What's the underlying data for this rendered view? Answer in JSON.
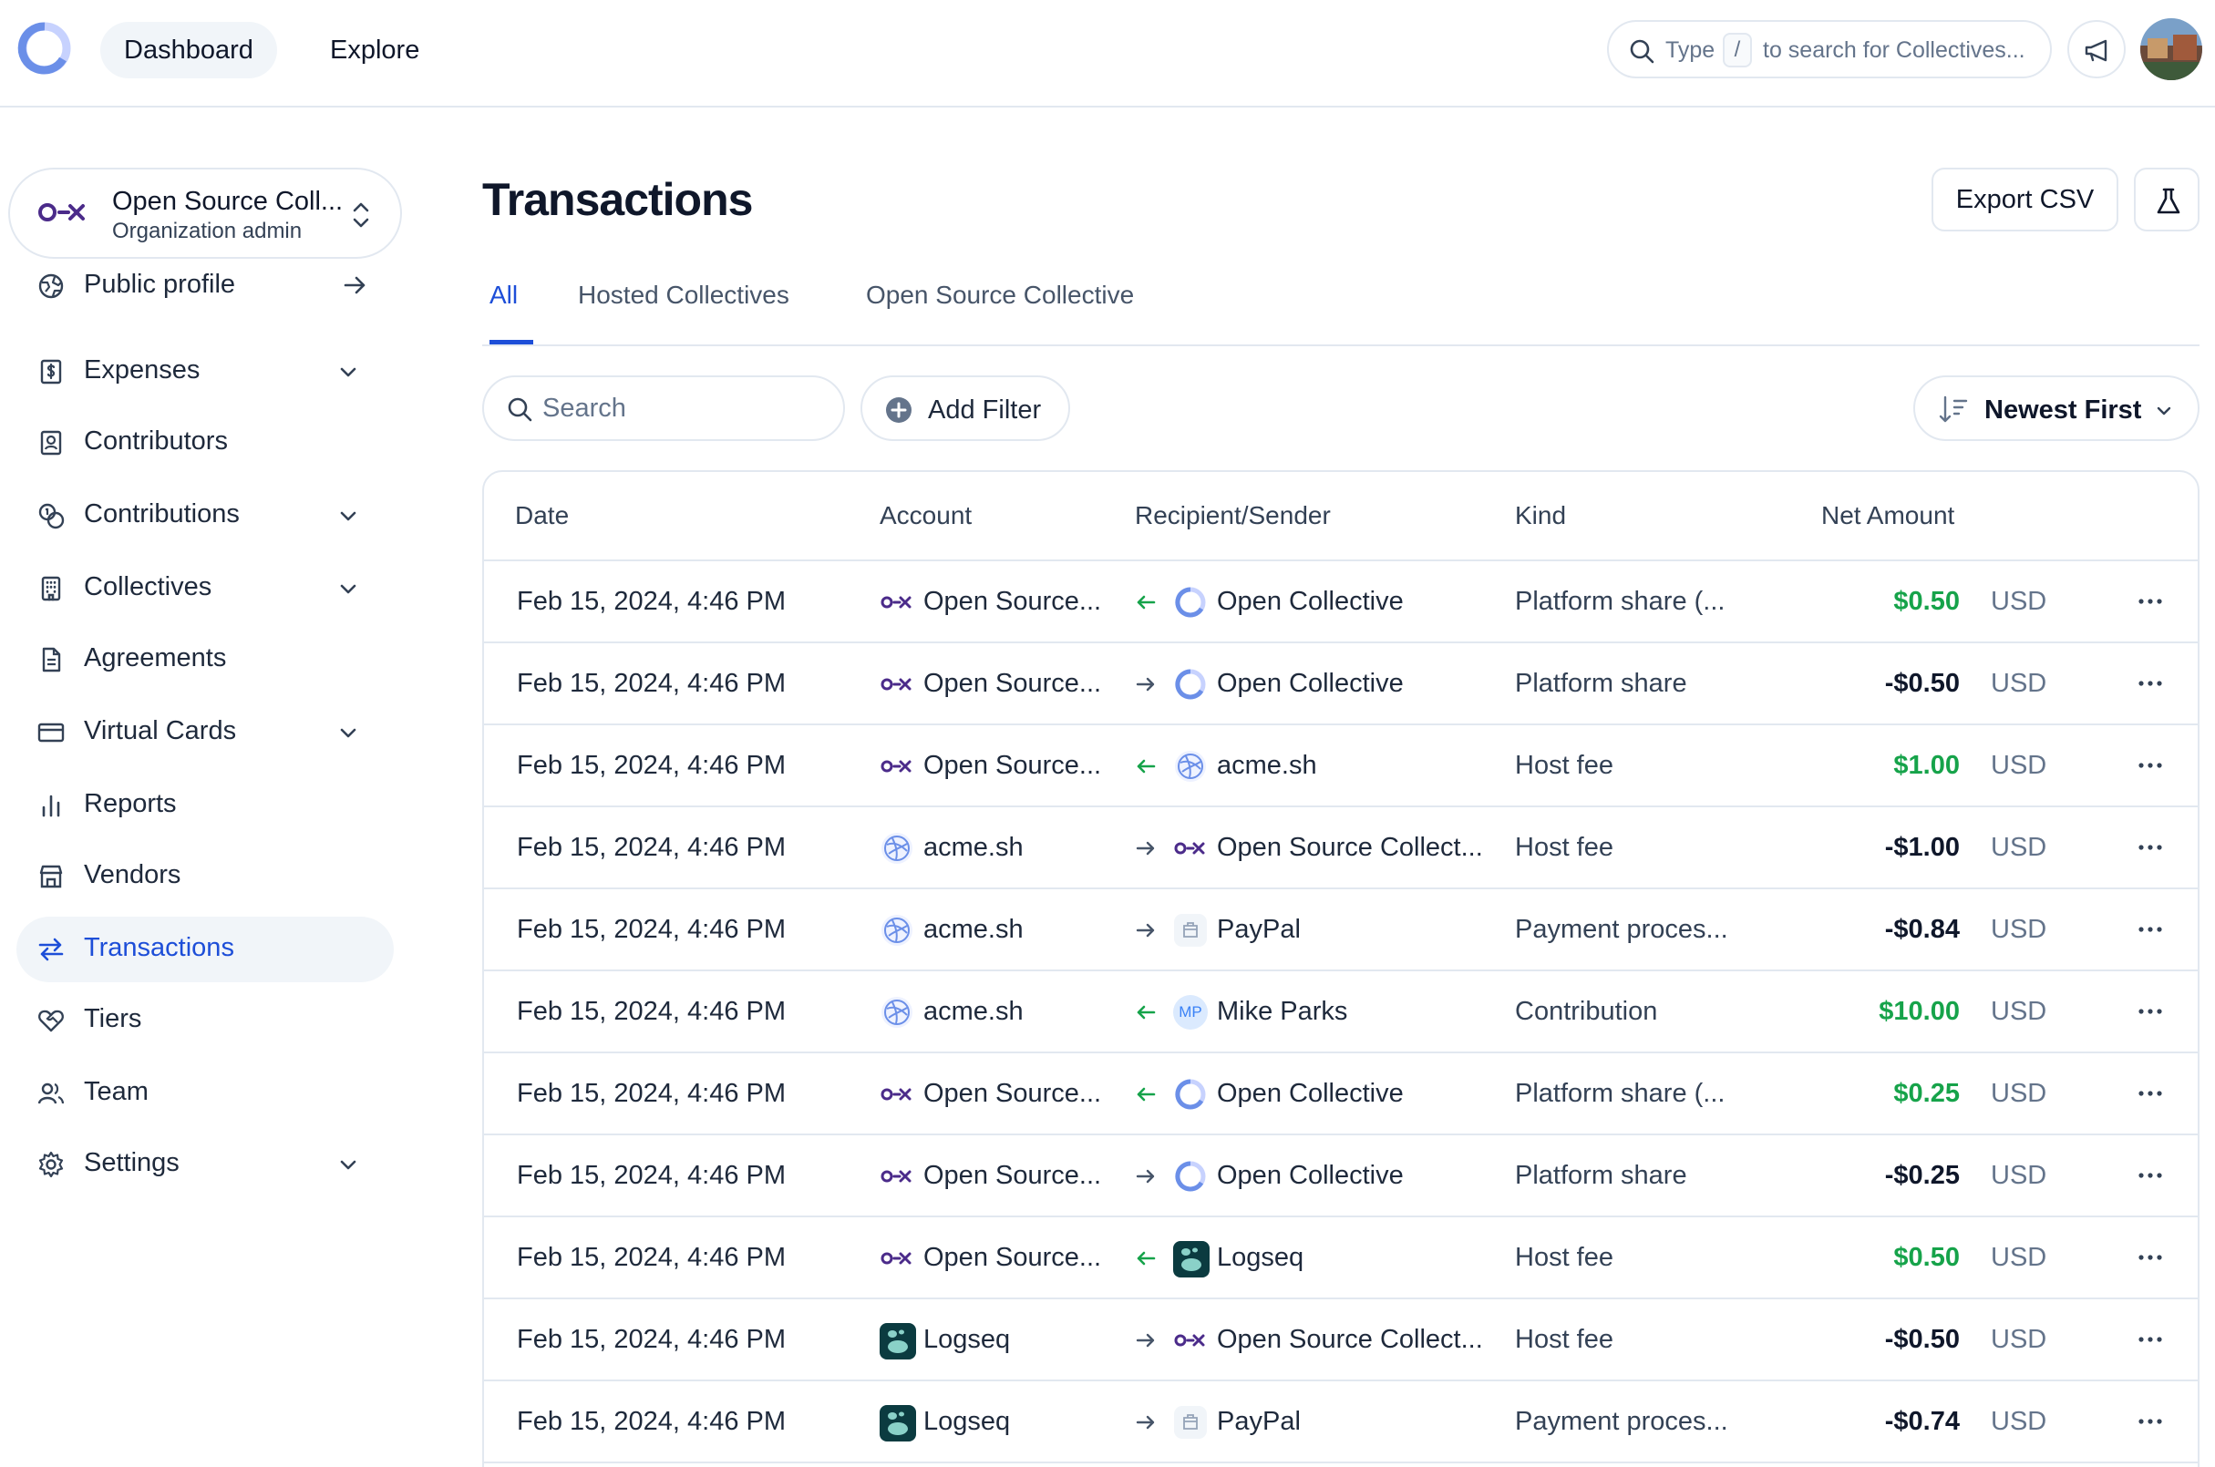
{
  "topbar": {
    "nav": [
      "Dashboard",
      "Explore"
    ],
    "search": {
      "prefix": "Type",
      "key": "/",
      "suffix": "to search for Collectives..."
    }
  },
  "org": {
    "name": "Open Source Coll...",
    "role": "Organization admin"
  },
  "sidebar": {
    "items": [
      {
        "label": "Public profile",
        "icon": "globe-icon",
        "suffix": "arrow-right"
      },
      {
        "label": "Expenses",
        "icon": "receipt-icon",
        "suffix": "chevron"
      },
      {
        "label": "Contributors",
        "icon": "contact-icon",
        "suffix": ""
      },
      {
        "label": "Contributions",
        "icon": "coins-icon",
        "suffix": "chevron"
      },
      {
        "label": "Collectives",
        "icon": "building-icon",
        "suffix": "chevron"
      },
      {
        "label": "Agreements",
        "icon": "file-icon",
        "suffix": ""
      },
      {
        "label": "Virtual Cards",
        "icon": "credit-card-icon",
        "suffix": "chevron"
      },
      {
        "label": "Reports",
        "icon": "bar-chart-icon",
        "suffix": ""
      },
      {
        "label": "Vendors",
        "icon": "store-icon",
        "suffix": ""
      },
      {
        "label": "Transactions",
        "icon": "arrows-exchange-icon",
        "suffix": "",
        "active": true
      },
      {
        "label": "Tiers",
        "icon": "heart-handshake-icon",
        "suffix": ""
      },
      {
        "label": "Team",
        "icon": "users-icon",
        "suffix": ""
      },
      {
        "label": "Settings",
        "icon": "gear-icon",
        "suffix": "chevron"
      }
    ]
  },
  "main": {
    "title": "Transactions",
    "export_label": "Export CSV",
    "tabs": [
      "All",
      "Hosted Collectives",
      "Open Source Collective"
    ],
    "search_placeholder": "Search",
    "add_filter_label": "Add Filter",
    "sort_label": "Newest First"
  },
  "table": {
    "headers": [
      "Date",
      "Account",
      "Recipient/Sender",
      "Kind",
      "Net Amount"
    ],
    "rows": [
      {
        "date": "Feb 15, 2024, 4:46 PM",
        "account": "Open Source...",
        "account_icon": "osc",
        "direction": "in",
        "recipient": "Open Collective",
        "recipient_icon": "oc",
        "kind": "Platform share (...",
        "amount": "$0.50",
        "positive": true,
        "currency": "USD"
      },
      {
        "date": "Feb 15, 2024, 4:46 PM",
        "account": "Open Source...",
        "account_icon": "osc",
        "direction": "out",
        "recipient": "Open Collective",
        "recipient_icon": "oc",
        "kind": "Platform share",
        "amount": "-$0.50",
        "positive": false,
        "currency": "USD"
      },
      {
        "date": "Feb 15, 2024, 4:46 PM",
        "account": "Open Source...",
        "account_icon": "osc",
        "direction": "in",
        "recipient": "acme.sh",
        "recipient_icon": "acme",
        "kind": "Host fee",
        "amount": "$1.00",
        "positive": true,
        "currency": "USD"
      },
      {
        "date": "Feb 15, 2024, 4:46 PM",
        "account": "acme.sh",
        "account_icon": "acme",
        "direction": "out",
        "recipient": "Open Source Collect...",
        "recipient_icon": "osc",
        "kind": "Host fee",
        "amount": "-$1.00",
        "positive": false,
        "currency": "USD"
      },
      {
        "date": "Feb 15, 2024, 4:46 PM",
        "account": "acme.sh",
        "account_icon": "acme",
        "direction": "out",
        "recipient": "PayPal",
        "recipient_icon": "paypal",
        "kind": "Payment proces...",
        "amount": "-$0.84",
        "positive": false,
        "currency": "USD"
      },
      {
        "date": "Feb 15, 2024, 4:46 PM",
        "account": "acme.sh",
        "account_icon": "acme",
        "direction": "in",
        "recipient": "Mike Parks",
        "recipient_icon": "mp",
        "recipient_initials": "MP",
        "kind": "Contribution",
        "amount": "$10.00",
        "positive": true,
        "currency": "USD"
      },
      {
        "date": "Feb 15, 2024, 4:46 PM",
        "account": "Open Source...",
        "account_icon": "osc",
        "direction": "in",
        "recipient": "Open Collective",
        "recipient_icon": "oc",
        "kind": "Platform share (...",
        "amount": "$0.25",
        "positive": true,
        "currency": "USD"
      },
      {
        "date": "Feb 15, 2024, 4:46 PM",
        "account": "Open Source...",
        "account_icon": "osc",
        "direction": "out",
        "recipient": "Open Collective",
        "recipient_icon": "oc",
        "kind": "Platform share",
        "amount": "-$0.25",
        "positive": false,
        "currency": "USD"
      },
      {
        "date": "Feb 15, 2024, 4:46 PM",
        "account": "Open Source...",
        "account_icon": "osc",
        "direction": "in",
        "recipient": "Logseq",
        "recipient_icon": "logseq",
        "kind": "Host fee",
        "amount": "$0.50",
        "positive": true,
        "currency": "USD"
      },
      {
        "date": "Feb 15, 2024, 4:46 PM",
        "account": "Logseq",
        "account_icon": "logseq",
        "direction": "out",
        "recipient": "Open Source Collect...",
        "recipient_icon": "osc",
        "kind": "Host fee",
        "amount": "-$0.50",
        "positive": false,
        "currency": "USD"
      },
      {
        "date": "Feb 15, 2024, 4:46 PM",
        "account": "Logseq",
        "account_icon": "logseq",
        "direction": "out",
        "recipient": "PayPal",
        "recipient_icon": "paypal",
        "kind": "Payment proces...",
        "amount": "-$0.74",
        "positive": false,
        "currency": "USD"
      }
    ]
  },
  "colors": {
    "accent": "#1d4ed8",
    "positive": "#16a34a",
    "border": "#e2e8f0",
    "osc_brand": "#4b2b8a"
  }
}
